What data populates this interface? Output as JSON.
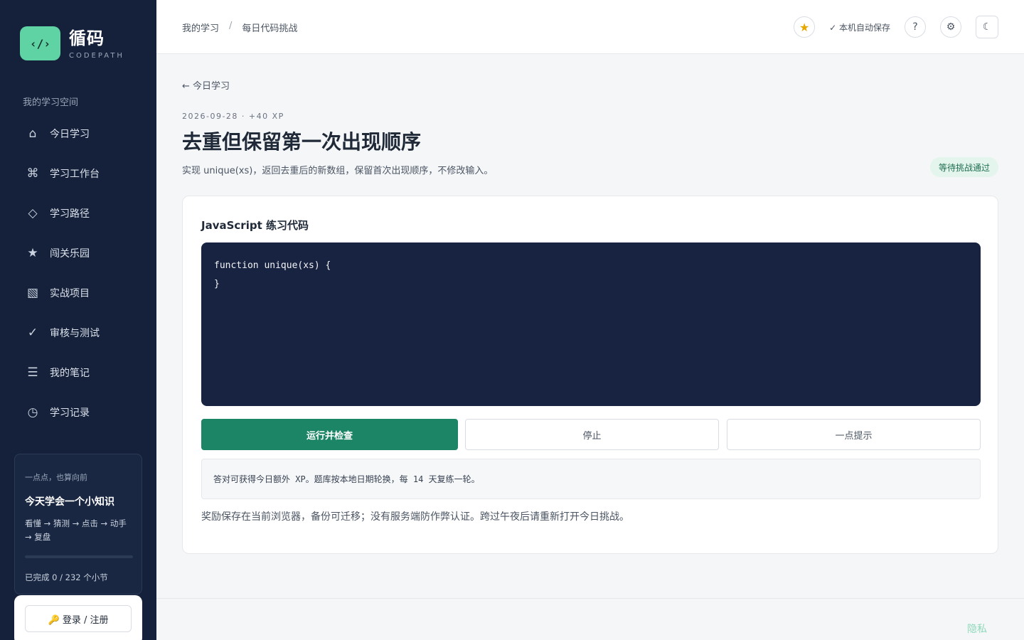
{
  "brand": {
    "logo_glyph": "‹/›",
    "name": "循码",
    "subtitle": "CODEPATH"
  },
  "sidebar": {
    "heading": "我的学习空间",
    "items": [
      {
        "label": "今日学习",
        "icon": "home-icon",
        "glyph": "⌂"
      },
      {
        "label": "学习工作台",
        "icon": "command-icon",
        "glyph": "⌘"
      },
      {
        "label": "学习路径",
        "icon": "diamond-icon",
        "glyph": "◇"
      },
      {
        "label": "闯关乐园",
        "icon": "star-icon",
        "glyph": "★"
      },
      {
        "label": "实战项目",
        "icon": "hatch-icon",
        "glyph": "▧"
      },
      {
        "label": "审核与测试",
        "icon": "check-icon",
        "glyph": "✓"
      },
      {
        "label": "我的笔记",
        "icon": "notes-icon",
        "glyph": "☰"
      },
      {
        "label": "学习记录",
        "icon": "clock-icon",
        "glyph": "◷"
      }
    ],
    "tip": {
      "kicker": "一点点，也算向前",
      "title": "今天学会一个小知识",
      "desc": "看懂 → 猜测 → 点击 → 动手 → 复盘",
      "progress_text": "已完成 0 / 232 个小节",
      "progress_fraction": 0
    },
    "login_label": "🔑 登录 / 注册"
  },
  "header": {
    "breadcrumb": [
      "我的学习",
      "每日代码挑战"
    ],
    "breadcrumb_sep": "/",
    "star_glyph": "★",
    "saved_label": "✓ 本机自动保存",
    "help_glyph": "?",
    "settings_glyph": "⚙",
    "theme_glyph": "☾"
  },
  "main": {
    "back_label": "← 今日学习",
    "meta": "2026-09-28 · +40 XP",
    "title": "去重但保留第一次出现顺序",
    "desc": "实现 unique(xs)，返回去重后的新数组，保留首次出现顺序，不修改输入。",
    "status": "等待挑战通过",
    "card": {
      "title": "JavaScript 练习代码",
      "code": "function unique(xs) {\n}",
      "run_label": "运行并检查",
      "stop_label": "停止",
      "hint_label": "一点提示",
      "notice": "答对可获得今日额外 XP。题库按本地日期轮换，每 14 天复练一轮。",
      "footnote": "奖励保存在当前浏览器，备份可迁移；没有服务端防作弊认证。跨过午夜后请重新打开今日挑战。"
    }
  },
  "footer": {
    "privacy": "隐私"
  },
  "colors": {
    "accent": "#1c8565",
    "brand_green": "#5fd3a4",
    "sidebar_bg": "#15213a",
    "editor_bg": "#172340"
  }
}
